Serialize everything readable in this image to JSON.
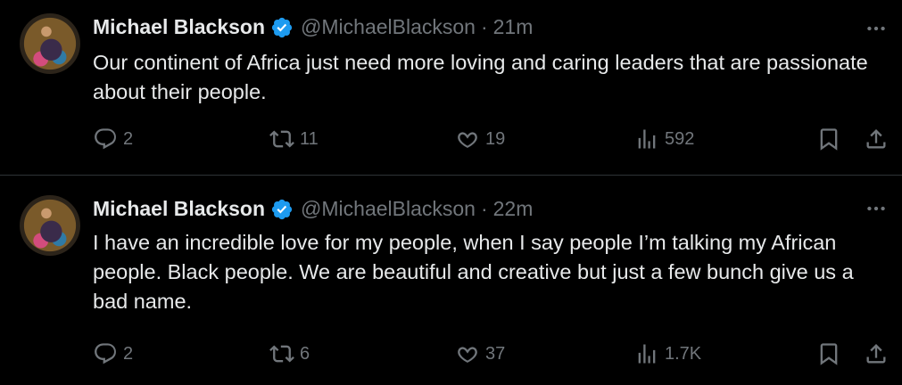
{
  "tweets": [
    {
      "name": "Michael Blackson",
      "handle": "@MichaelBlackson",
      "separator": "·",
      "time": "21m",
      "text": "Our continent of Africa just need more loving and caring leaders that are passionate about their people.",
      "replies": "2",
      "retweets": "11",
      "likes": "19",
      "views": "592"
    },
    {
      "name": "Michael Blackson",
      "handle": "@MichaelBlackson",
      "separator": "·",
      "time": "22m",
      "text": "I have an incredible love for my people, when I say people I’m talking my African people. Black people. We are beautiful and creative but just a few bunch give us a bad name.",
      "replies": "2",
      "retweets": "6",
      "likes": "37",
      "views": "1.7K"
    }
  ],
  "icons": {
    "verified": "verified-badge-icon",
    "more": "more-dots-icon",
    "reply": "reply-icon",
    "retweet": "retweet-icon",
    "like": "heart-icon",
    "views": "views-chart-icon",
    "bookmark": "bookmark-icon",
    "share": "share-icon"
  },
  "colors": {
    "background": "#000000",
    "text": "#e7e9ea",
    "muted": "#71767b",
    "verified": "#1d9bf0",
    "divider": "#2f3336"
  }
}
